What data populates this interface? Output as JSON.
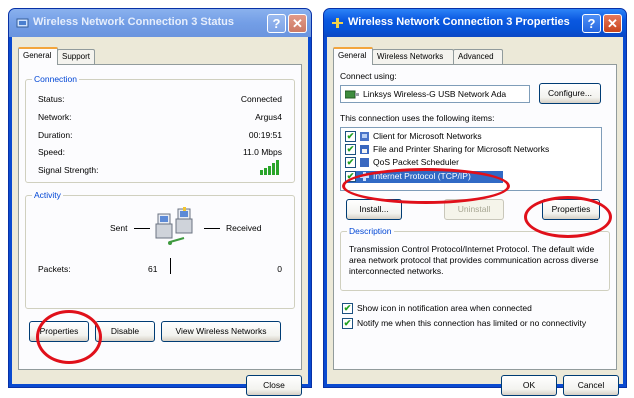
{
  "left_dialog": {
    "title": "Wireless Network Connection 3 Status",
    "help_glyph": "?",
    "close_glyph": "✕",
    "tabs": [
      {
        "label": "General"
      },
      {
        "label": "Support"
      }
    ],
    "connection": {
      "legend": "Connection",
      "rows": [
        {
          "label": "Status:",
          "value": "Connected"
        },
        {
          "label": "Network:",
          "value": "Argus4"
        },
        {
          "label": "Duration:",
          "value": "00:19:51"
        },
        {
          "label": "Speed:",
          "value": "11.0 Mbps"
        },
        {
          "label": "Signal Strength:",
          "value": ""
        }
      ]
    },
    "activity": {
      "legend": "Activity",
      "sent_label": "Sent",
      "received_label": "Received",
      "packets_label": "Packets:",
      "packets_sent": "61",
      "packets_received": "0"
    },
    "buttons": {
      "properties": "Properties",
      "disable": "Disable",
      "view_networks": "View Wireless Networks",
      "close": "Close"
    }
  },
  "right_dialog": {
    "title": "Wireless Network Connection 3 Properties",
    "help_glyph": "?",
    "close_glyph": "✕",
    "tabs": [
      {
        "label": "General"
      },
      {
        "label": "Wireless Networks"
      },
      {
        "label": "Advanced"
      }
    ],
    "connect_using_label": "Connect using:",
    "adapter_name": "Linksys Wireless-G USB Network Ada",
    "configure_button": "Configure...",
    "items_label": "This connection uses the following items:",
    "items": [
      {
        "label": "Client for Microsoft Networks",
        "checked": true
      },
      {
        "label": "File and Printer Sharing for Microsoft Networks",
        "checked": true
      },
      {
        "label": "QoS Packet Scheduler",
        "checked": true
      },
      {
        "label": "Internet Protocol (TCP/IP)",
        "checked": true,
        "selected": true
      }
    ],
    "check_glyph": "✔",
    "buttons": {
      "install": "Install...",
      "uninstall": "Uninstall",
      "properties": "Properties",
      "ok": "OK",
      "cancel": "Cancel"
    },
    "description": {
      "legend": "Description",
      "text": "Transmission Control Protocol/Internet Protocol. The default wide area network protocol that provides communication across diverse interconnected networks."
    },
    "show_icon_label": "Show icon in notification area when connected",
    "notify_label": "Notify me when this connection has limited or no connectivity"
  },
  "colors": {
    "annotation_red": "#e0101a",
    "xp_blue": "#0a58e0",
    "group_legend": "#0046d5"
  }
}
